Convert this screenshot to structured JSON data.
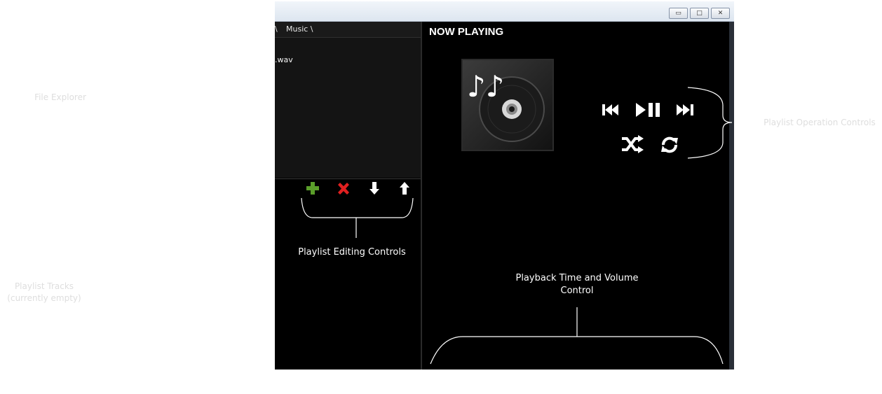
{
  "external_labels": {
    "file_explorer": "File Explorer",
    "playlist_tracks_line1": "Playlist Tracks",
    "playlist_tracks_line2": "(currently empty)",
    "playlist_operation": "Playlist Operation Controls"
  },
  "window": {
    "controls": {
      "minimize": "▭",
      "maximize": "□",
      "close": "✕"
    }
  },
  "file_explorer": {
    "breadcrumb_separator": "\\",
    "breadcrumb_folder": "Music \\",
    "files": [
      ".wav"
    ]
  },
  "editing_controls": {
    "add_icon": "plus-icon",
    "remove_icon": "remove-icon",
    "move_down_icon": "arrow-down-icon",
    "move_up_icon": "arrow-up-icon",
    "colors": {
      "add": "#5a9e2a",
      "remove": "#e02020",
      "arrows": "#ffffff"
    }
  },
  "now_playing": {
    "title": "NOW PLAYING",
    "album_art_icon": "music-disc-icon"
  },
  "playback_controls": {
    "previous_icon": "skip-back-icon",
    "play_pause_icon": "play-pause-icon",
    "next_icon": "skip-forward-icon",
    "shuffle_icon": "shuffle-icon",
    "repeat_icon": "repeat-icon"
  },
  "annotations": {
    "playlist_editing": "Playlist Editing Controls",
    "playback_time_line1": "Playback Time and Volume",
    "playback_time_line2": "Control"
  }
}
